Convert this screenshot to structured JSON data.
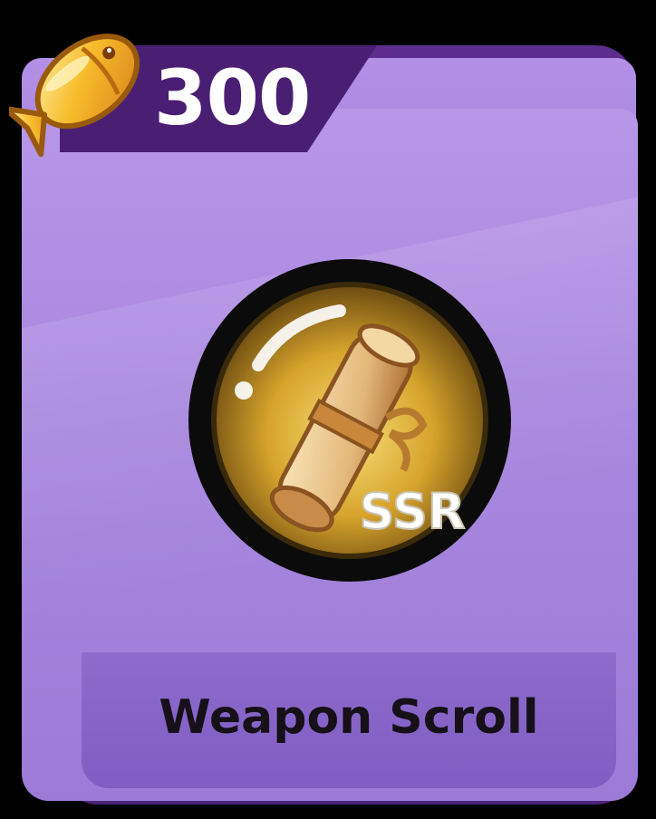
{
  "card": {
    "price": "300",
    "currency_icon": "golden-fish-icon",
    "item_icon": "ssr-scroll-icon",
    "item_badge_text": "SSR",
    "item_name": "Weapon Scroll"
  },
  "colors": {
    "card_frame": "#4c2378",
    "card_body": "#a989e0",
    "footer": "#8060c4",
    "gold": "#e6b02e",
    "badge_ring": "#111111"
  }
}
